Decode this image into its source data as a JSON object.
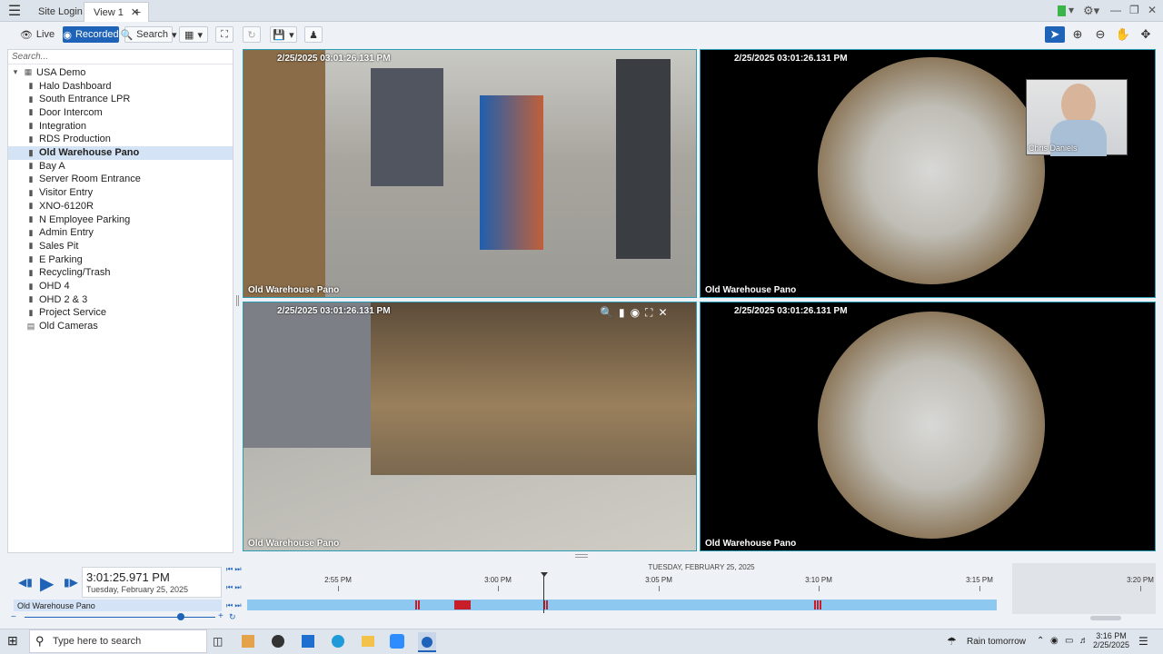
{
  "tabs": [
    {
      "label": "Site Login"
    },
    {
      "label": "View 1"
    }
  ],
  "toolbar": {
    "live": "Live",
    "recorded": "Recorded",
    "search": "Search"
  },
  "tree": {
    "search_placeholder": "Search...",
    "root": "USA Demo",
    "items": [
      {
        "label": "Halo Dashboard"
      },
      {
        "label": "South Entrance LPR"
      },
      {
        "label": "Door Intercom"
      },
      {
        "label": "Integration"
      },
      {
        "label": "RDS Production"
      },
      {
        "label": "Old Warehouse Pano"
      },
      {
        "label": "Bay A"
      },
      {
        "label": "Server Room Entrance"
      },
      {
        "label": "Visitor Entry"
      },
      {
        "label": "XNO-6120R"
      },
      {
        "label": "N Employee Parking"
      },
      {
        "label": "Admin Entry"
      },
      {
        "label": "Sales Pit"
      },
      {
        "label": "E Parking"
      },
      {
        "label": "Recycling/Trash"
      },
      {
        "label": "OHD 4"
      },
      {
        "label": "OHD 2 & 3"
      },
      {
        "label": "Project Service"
      },
      {
        "label": "Old Cameras"
      }
    ]
  },
  "cameras": [
    {
      "timestamp": "2/25/2025 03:01:26.131 PM",
      "name": "Old Warehouse Pano"
    },
    {
      "timestamp": "2/25/2025 03:01:26.131 PM",
      "name": "Old Warehouse Pano"
    },
    {
      "timestamp": "2/25/2025 03:01:26.131 PM",
      "name": "Old Warehouse Pano"
    },
    {
      "timestamp": "2/25/2025 03:01:26.131 PM",
      "name": "Old Warehouse Pano"
    }
  ],
  "video_call": {
    "participant": "Chris Daniels"
  },
  "playback": {
    "time": "3:01:25.971 PM",
    "date": "Tuesday, February 25, 2025",
    "camera": "Old Warehouse Pano"
  },
  "timeline": {
    "date_header": "TUESDAY, FEBRUARY 25, 2025",
    "ticks": [
      "2:55 PM",
      "3:00 PM",
      "3:05 PM",
      "3:10 PM",
      "3:15 PM",
      "3:20 PM"
    ]
  },
  "taskbar": {
    "search_placeholder": "Type here to search",
    "weather": "Rain tomorrow",
    "time": "3:16 PM",
    "date": "2/25/2025"
  },
  "colors": {
    "accent": "#1e63b8",
    "timeline_bar": "#8cc8f0",
    "motion": "#c81e2a",
    "cam_border": "#2a9db5"
  }
}
